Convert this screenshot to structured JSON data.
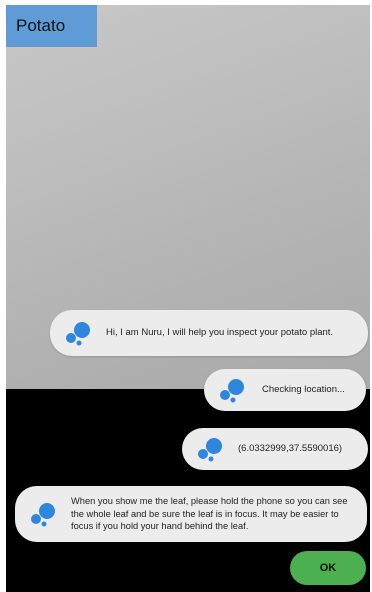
{
  "header": {
    "title": "Potato"
  },
  "messages": [
    {
      "icon": "chat-bubble-icon",
      "text": "Hi, I am Nuru, I will help you inspect your potato plant."
    },
    {
      "icon": "chat-bubble-icon",
      "text": "Checking location..."
    },
    {
      "icon": "chat-bubble-icon",
      "text": "(6.0332999,37.5590016)"
    },
    {
      "icon": "chat-bubble-icon",
      "text": "When you show me the leaf, please hold the phone so you can see the whole leaf and be sure the leaf is in focus. It may be easier to focus if you hold your hand  behind the leaf."
    }
  ],
  "actions": {
    "ok_label": "OK"
  },
  "colors": {
    "title_chip": "#5f9bd6",
    "bubble": "#ececec",
    "icon": "#2e86de",
    "ok_button": "#4caf50"
  }
}
